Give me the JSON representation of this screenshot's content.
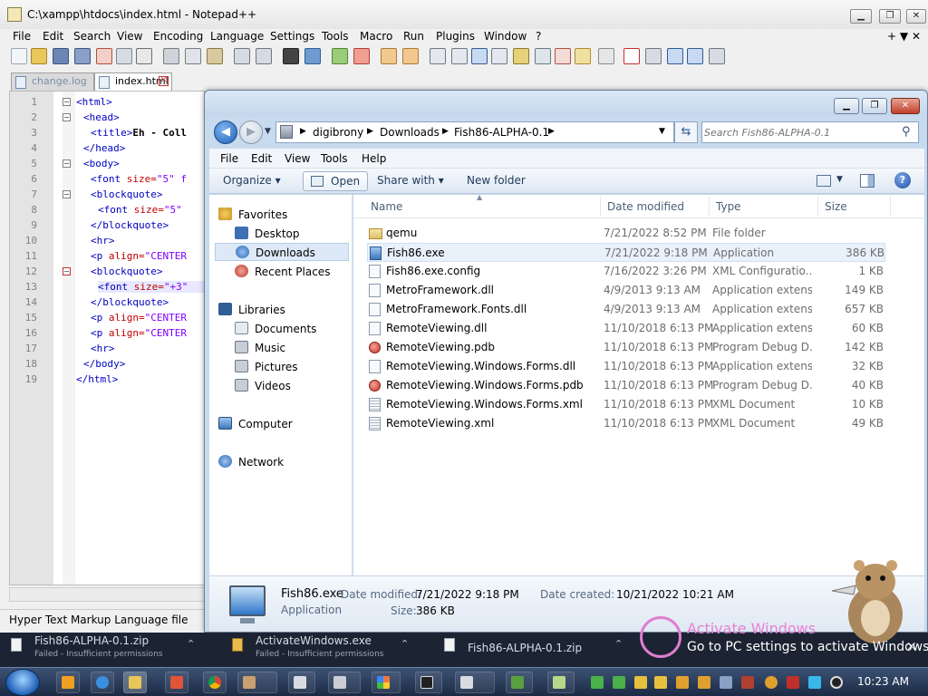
{
  "notepad": {
    "title": "C:\\xampp\\htdocs\\index.html - Notepad++",
    "menu": [
      "File",
      "Edit",
      "Search",
      "View",
      "Encoding",
      "Language",
      "Settings",
      "Tools",
      "Macro",
      "Run",
      "Plugins",
      "Window",
      "?"
    ],
    "menu_right": "+ ▼ ✕",
    "tabs": [
      {
        "label": "change.log",
        "active": false
      },
      {
        "label": "index.html",
        "active": true
      }
    ],
    "code_lines": [
      {
        "n": "1",
        "tag": "<html>",
        "attr": "",
        "val": "",
        "text": ""
      },
      {
        "n": "2",
        "tag": "<head>",
        "attr": "",
        "val": "",
        "text": ""
      },
      {
        "n": "3",
        "tag": "<title>",
        "attr": "",
        "val": "",
        "text": "Eh - Coll"
      },
      {
        "n": "4",
        "tag": "</head>",
        "attr": "",
        "val": "",
        "text": ""
      },
      {
        "n": "5",
        "tag": "<body>",
        "attr": "",
        "val": "",
        "text": ""
      },
      {
        "n": "6",
        "tag": "<font ",
        "attr": "size=",
        "val": "\"5\" f",
        "text": ""
      },
      {
        "n": "7",
        "tag": "<blockquote>",
        "attr": "",
        "val": "",
        "text": ""
      },
      {
        "n": "8",
        "tag": "<font ",
        "attr": "size=",
        "val": "\"5\"",
        "text": ""
      },
      {
        "n": "9",
        "tag": "</blockquote>",
        "attr": "",
        "val": "",
        "text": ""
      },
      {
        "n": "10",
        "tag": "<hr>",
        "attr": "",
        "val": "",
        "text": ""
      },
      {
        "n": "11",
        "tag": "<p ",
        "attr": "align=",
        "val": "\"CENTER",
        "text": ""
      },
      {
        "n": "12",
        "tag": "<blockquote>",
        "attr": "",
        "val": "",
        "text": ""
      },
      {
        "n": "13",
        "tag": "<font ",
        "attr": "size=",
        "val": "\"+3\"",
        "text": ""
      },
      {
        "n": "14",
        "tag": "</blockquote>",
        "attr": "",
        "val": "",
        "text": ""
      },
      {
        "n": "15",
        "tag": "<p ",
        "attr": "align=",
        "val": "\"CENTER",
        "text": ""
      },
      {
        "n": "16",
        "tag": "<p ",
        "attr": "align=",
        "val": "\"CENTER",
        "text": ""
      },
      {
        "n": "17",
        "tag": "<hr>",
        "attr": "",
        "val": "",
        "text": ""
      },
      {
        "n": "18",
        "tag": "</body>",
        "attr": "",
        "val": "",
        "text": ""
      },
      {
        "n": "19",
        "tag": "</html>",
        "attr": "",
        "val": "",
        "text": ""
      }
    ],
    "status_text": "Hyper Text Markup Language file"
  },
  "explorer": {
    "breadcrumb": [
      "digibrony",
      "Downloads",
      "Fish86-ALPHA-0.1"
    ],
    "search_placeholder": "Search Fish86-ALPHA-0.1",
    "menu": [
      "File",
      "Edit",
      "View",
      "Tools",
      "Help"
    ],
    "commands": {
      "organize": "Organize ▾",
      "open": "Open",
      "share": "Share with ▾",
      "new_folder": "New folder"
    },
    "nav": {
      "favorites": "Favorites",
      "favorites_items": [
        "Desktop",
        "Downloads",
        "Recent Places"
      ],
      "selected": "Downloads",
      "libraries": "Libraries",
      "libraries_items": [
        "Documents",
        "Music",
        "Pictures",
        "Videos"
      ],
      "computer": "Computer",
      "network": "Network"
    },
    "columns": [
      "Name",
      "Date modified",
      "Type",
      "Size"
    ],
    "files": [
      {
        "name": "qemu",
        "date": "7/21/2022 8:52 PM",
        "type": "File folder",
        "size": "",
        "icon": "folder-icon"
      },
      {
        "name": "Fish86.exe",
        "date": "7/21/2022 9:18 PM",
        "type": "Application",
        "size": "386 KB",
        "icon": "application-icon"
      },
      {
        "name": "Fish86.exe.config",
        "date": "7/16/2022 3:26 PM",
        "type": "XML Configuratio...",
        "size": "1 KB",
        "icon": "config-file-icon"
      },
      {
        "name": "MetroFramework.dll",
        "date": "4/9/2013 9:13 AM",
        "type": "Application extens...",
        "size": "149 KB",
        "icon": "dll-file-icon"
      },
      {
        "name": "MetroFramework.Fonts.dll",
        "date": "4/9/2013 9:13 AM",
        "type": "Application extens...",
        "size": "657 KB",
        "icon": "dll-file-icon"
      },
      {
        "name": "RemoteViewing.dll",
        "date": "11/10/2018 6:13 PM",
        "type": "Application extens...",
        "size": "60 KB",
        "icon": "dll-file-icon"
      },
      {
        "name": "RemoteViewing.pdb",
        "date": "11/10/2018 6:13 PM",
        "type": "Program Debug D...",
        "size": "142 KB",
        "icon": "pdb-file-icon"
      },
      {
        "name": "RemoteViewing.Windows.Forms.dll",
        "date": "11/10/2018 6:13 PM",
        "type": "Application extens...",
        "size": "32 KB",
        "icon": "dll-file-icon"
      },
      {
        "name": "RemoteViewing.Windows.Forms.pdb",
        "date": "11/10/2018 6:13 PM",
        "type": "Program Debug D...",
        "size": "40 KB",
        "icon": "pdb-file-icon"
      },
      {
        "name": "RemoteViewing.Windows.Forms.xml",
        "date": "11/10/2018 6:13 PM",
        "type": "XML Document",
        "size": "10 KB",
        "icon": "xml-file-icon"
      },
      {
        "name": "RemoteViewing.xml",
        "date": "11/10/2018 6:13 PM",
        "type": "XML Document",
        "size": "49 KB",
        "icon": "xml-file-icon"
      }
    ],
    "selected_file": "Fish86.exe",
    "details": {
      "name": "Fish86.exe",
      "type": "Application",
      "date_modified_label": "Date modified:",
      "date_modified": "7/21/2022 9:18 PM",
      "date_created_label": "Date created:",
      "date_created": "10/21/2022 10:21 AM",
      "size_label": "Size:",
      "size": "386 KB"
    }
  },
  "notifications": [
    {
      "name": "Fish86-ALPHA-0.1.zip",
      "status": "Failed - Insufficient permissions"
    },
    {
      "name": "ActivateWindows.exe",
      "status": "Failed - Insufficient permissions"
    },
    {
      "name": "Fish86-ALPHA-0.1.zip",
      "status": ""
    }
  ],
  "watermark": {
    "title": "Activate Windows",
    "subtitle": "Go to PC settings to activate Windows."
  },
  "taskbar": {
    "clock": "10:23 AM"
  },
  "colors": {
    "accent": "#1f5fb6",
    "selection": "#dde9f7",
    "watermark": "#e780d6"
  }
}
